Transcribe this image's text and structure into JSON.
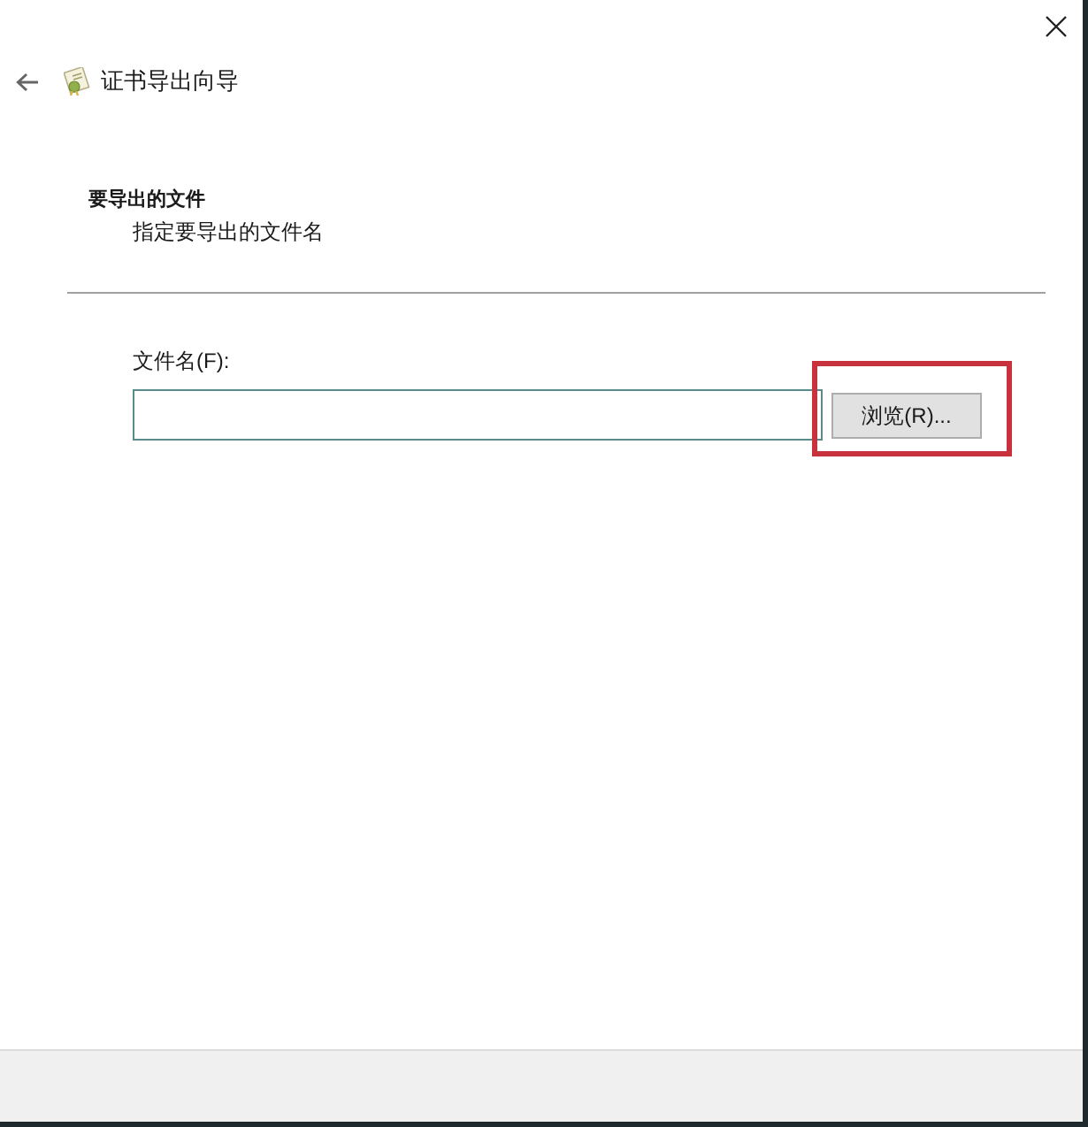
{
  "window": {
    "title": "证书导出向导"
  },
  "page": {
    "heading": "要导出的文件",
    "subheading": "指定要导出的文件名"
  },
  "file_name_field": {
    "label": "文件名(F):"
  },
  "browse_button": {
    "label": "浏览(R)...",
    "highlighted": true
  }
}
